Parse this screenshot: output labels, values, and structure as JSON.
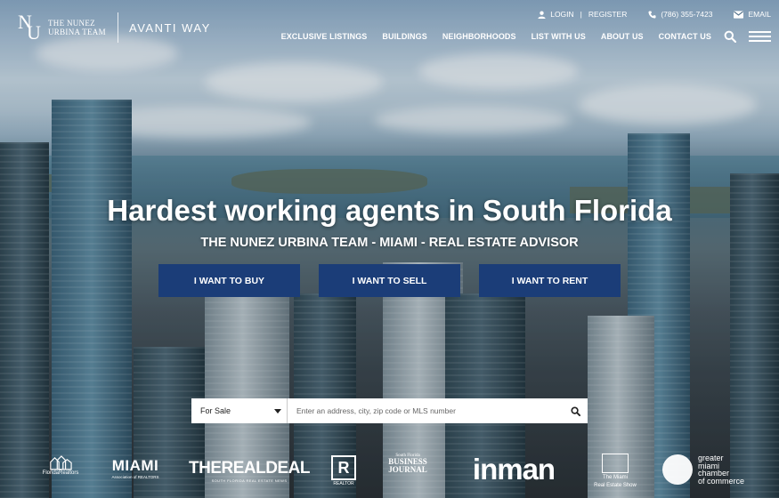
{
  "brand": {
    "logo_letters_n": "N",
    "logo_letters_u": "U",
    "team_line1": "THE NUNEZ",
    "team_line2": "URBINA TEAM",
    "company": "AVANTI WAY"
  },
  "topbar": {
    "login": "LOGIN",
    "separator": "|",
    "register": "REGISTER",
    "phone": "(786) 355-7423",
    "email": "EMAIL"
  },
  "nav": {
    "items": [
      "EXCLUSIVE LISTINGS",
      "BUILDINGS",
      "NEIGHBORHOODS",
      "LIST WITH US",
      "ABOUT US",
      "CONTACT US"
    ]
  },
  "hero": {
    "title": "Hardest working agents in South Florida",
    "subtitle": "THE NUNEZ URBINA TEAM - MIAMI - REAL ESTATE ADVISOR",
    "buttons": [
      "I WANT TO BUY",
      "I WANT TO SELL",
      "I WANT TO RENT"
    ],
    "button_color": "#1b3d78"
  },
  "search": {
    "type_value": "For Sale",
    "placeholder": "Enter an address, city, zip code or MLS number"
  },
  "press": {
    "florida_realtors": "FloridaRealtors",
    "miami": "MIAMI",
    "miami_sub": "Association of REALTORS",
    "therealdeal": "THEREALDEAL",
    "therealdeal_sub": "SOUTH FLORIDA REAL ESTATE NEWS",
    "realtor_mark": "R",
    "realtor": "REALTOR",
    "sfbj_line1": "South Florida",
    "sfbj_line2": "BUSINESS",
    "sfbj_line3": "JOURNAL",
    "inman": "inman",
    "show_line1": "The Miami",
    "show_line2": "Real Estate Show",
    "chamber_line1": "greater",
    "chamber_line2": "miami",
    "chamber_line3": "chamber",
    "chamber_line4": "of commerce"
  }
}
